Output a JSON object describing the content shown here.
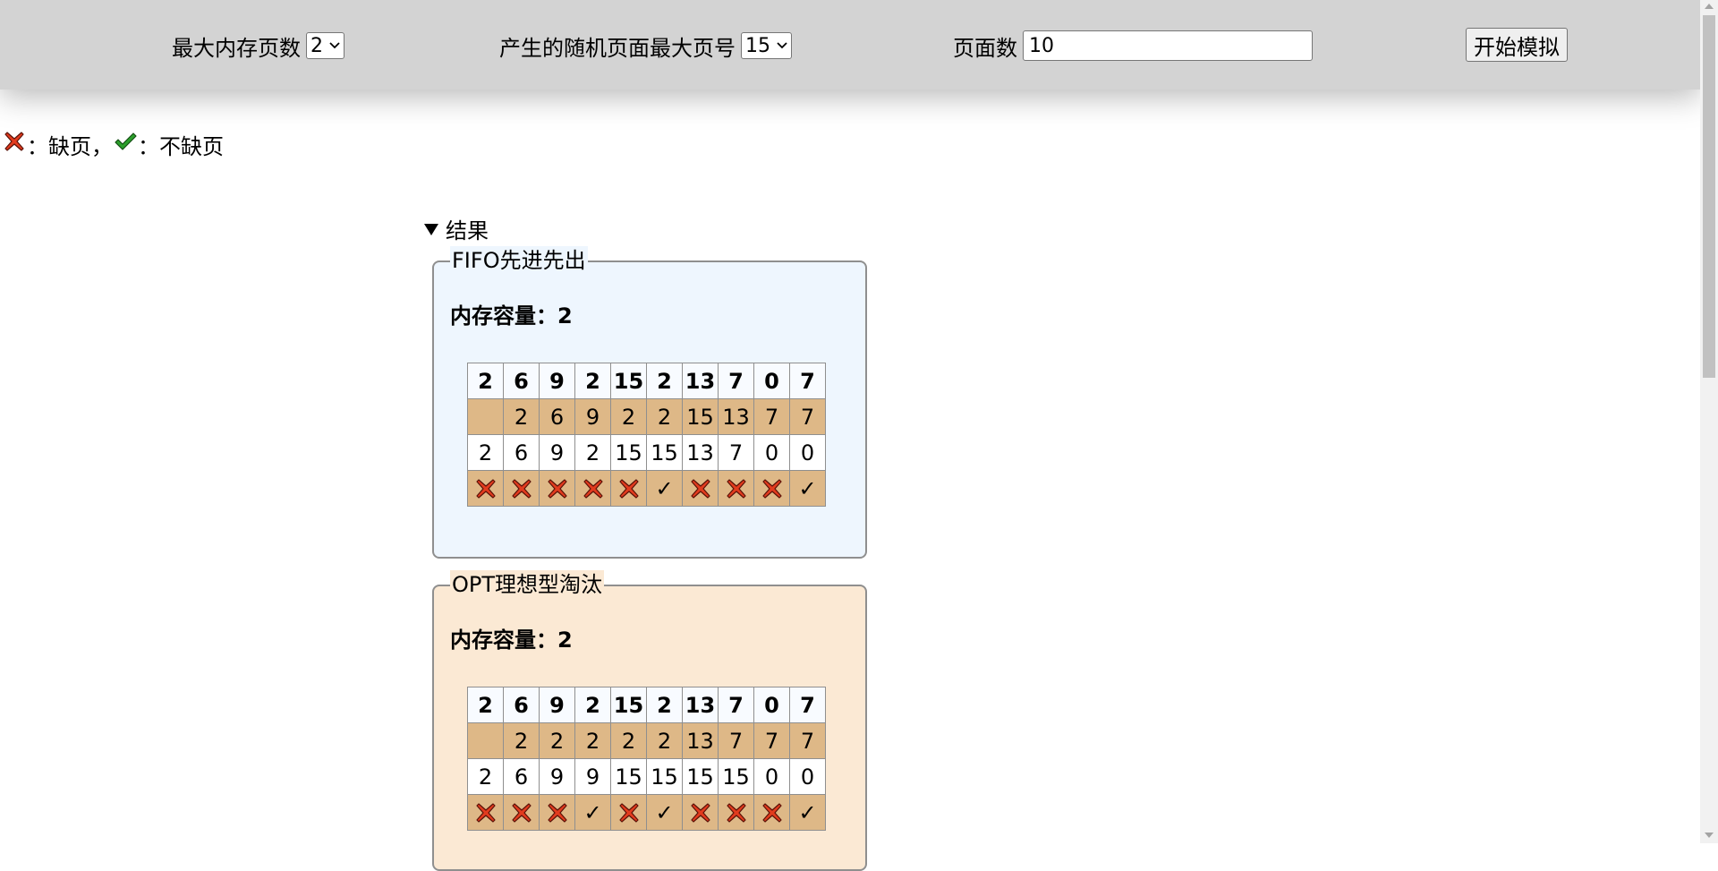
{
  "toolbar": {
    "max_mem_label": "最大内存页数",
    "max_mem_value": "2",
    "max_page_label": "产生的随机页面最大页号",
    "max_page_value": "15",
    "page_count_label": "页面数",
    "page_count_value": "10",
    "start_button": "开始模拟"
  },
  "legend": {
    "miss_text": "：缺页，",
    "hit_text": "：不缺页",
    "miss_icon": "red-cross-icon",
    "hit_icon": "green-check-icon"
  },
  "results": {
    "summary": "结果",
    "summary_icon": "triangle-down-icon"
  },
  "colors": {
    "toolbar_bg": "#d3d3d3",
    "fifo_bg": "#eef6fe",
    "opt_bg": "#fbe9d4",
    "alt_row_bg": "#deb887",
    "miss_red": "#e23b1e",
    "hit_green": "#2ca02c"
  },
  "fifo": {
    "title": "FIFO先进先出",
    "capacity": "内存容量：2",
    "sequence": [
      "2",
      "6",
      "9",
      "2",
      "15",
      "2",
      "13",
      "7",
      "0",
      "7"
    ],
    "slot1": [
      "",
      "2",
      "6",
      "9",
      "2",
      "2",
      "15",
      "13",
      "7",
      "7"
    ],
    "slot2": [
      "2",
      "6",
      "9",
      "2",
      "15",
      "15",
      "13",
      "7",
      "0",
      "0"
    ],
    "status": [
      "miss",
      "miss",
      "miss",
      "miss",
      "miss",
      "hit",
      "miss",
      "miss",
      "miss",
      "hit"
    ],
    "hit_symbol": "✓"
  },
  "opt": {
    "title": "OPT理想型淘汰",
    "capacity": "内存容量：2",
    "sequence": [
      "2",
      "6",
      "9",
      "2",
      "15",
      "2",
      "13",
      "7",
      "0",
      "7"
    ],
    "slot1": [
      "",
      "2",
      "2",
      "2",
      "2",
      "2",
      "13",
      "7",
      "7",
      "7"
    ],
    "slot2": [
      "2",
      "6",
      "9",
      "9",
      "15",
      "15",
      "15",
      "15",
      "0",
      "0"
    ],
    "status": [
      "miss",
      "miss",
      "miss",
      "hit",
      "miss",
      "hit",
      "miss",
      "miss",
      "miss",
      "hit"
    ],
    "hit_symbol": "✓"
  }
}
